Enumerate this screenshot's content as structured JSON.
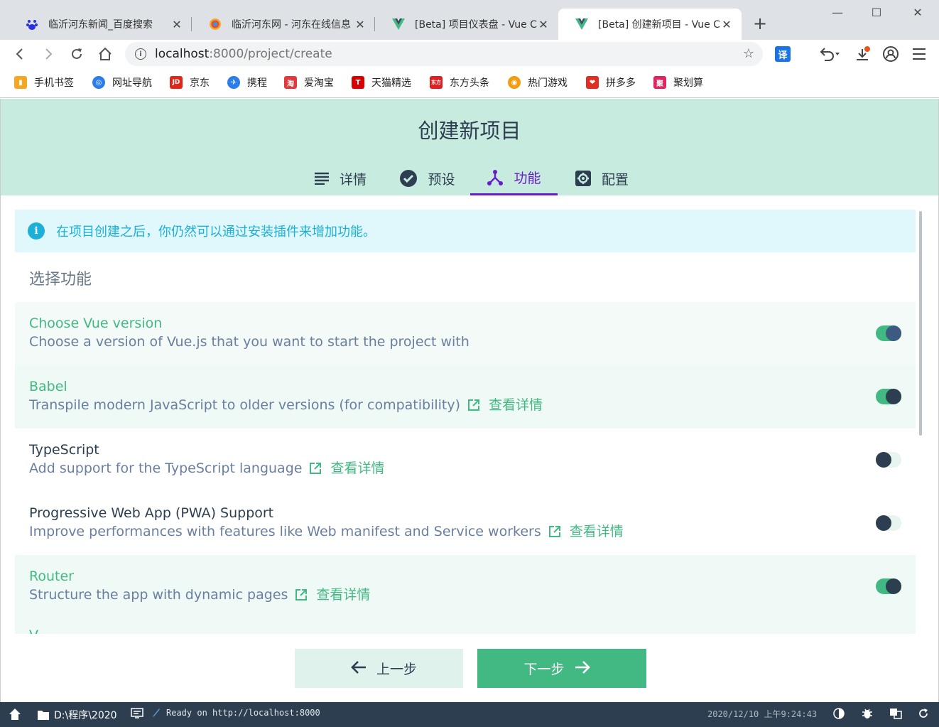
{
  "browser": {
    "tabs": [
      {
        "title": "临沂河东新闻_百度搜索",
        "icon": "baidu-icon",
        "active": false
      },
      {
        "title": "临沂河东网 - 河东在线信息",
        "icon": "rainbow-icon",
        "active": false
      },
      {
        "title": "[Beta] 项目仪表盘 - Vue CLI",
        "icon": "vue-icon",
        "active": false
      },
      {
        "title": "[Beta] 创建新项目 - Vue CLI",
        "icon": "vue-icon",
        "active": true
      }
    ],
    "close_glyph": "✕",
    "new_tab_glyph": "+",
    "url_host": "localhost",
    "url_path": ":8000/project/create",
    "translate_label": "译",
    "bookmarks": [
      {
        "label": "手机书签",
        "icon": "phone-bookmark-icon",
        "color": "#f5a623",
        "glyph": "▮"
      },
      {
        "label": "网址导航",
        "icon": "nav-icon",
        "color": "#2b7de9",
        "glyph": "◎"
      },
      {
        "label": "京东",
        "icon": "jd-icon",
        "color": "#e1251b",
        "glyph": "JD"
      },
      {
        "label": "携程",
        "icon": "ctrip-icon",
        "color": "#2b7de9",
        "glyph": "✈"
      },
      {
        "label": "爱淘宝",
        "icon": "taobao-icon",
        "color": "#e4393c",
        "glyph": "淘"
      },
      {
        "label": "天猫精选",
        "icon": "tmall-icon",
        "color": "#d80000",
        "glyph": "T"
      },
      {
        "label": "东方头条",
        "icon": "dftt-icon",
        "color": "#e02020",
        "glyph": "东方"
      },
      {
        "label": "热门游戏",
        "icon": "game-icon",
        "color": "#f39c12",
        "glyph": "◉"
      },
      {
        "label": "拼多多",
        "icon": "pdd-icon",
        "color": "#e02e24",
        "glyph": "❤"
      },
      {
        "label": "聚划算",
        "icon": "juhuasuan-icon",
        "color": "#e0245e",
        "glyph": "聚"
      }
    ]
  },
  "app": {
    "title": "创建新项目",
    "steps": [
      {
        "label": "详情",
        "icon": "list-icon",
        "active": false
      },
      {
        "label": "预设",
        "icon": "check-circle-icon",
        "active": false
      },
      {
        "label": "功能",
        "icon": "fork-icon",
        "active": true
      },
      {
        "label": "配置",
        "icon": "settings-icon",
        "active": false
      }
    ],
    "info_glyph": "i",
    "info_text": "在项目创建之后，你仍然可以通过安装插件来增加功能。",
    "section_title": "选择功能",
    "more_label": "查看详情",
    "features": [
      {
        "name": "Choose Vue version",
        "desc": "Choose a version of Vue.js that you want to start the project with",
        "enabled": true,
        "has_link": false
      },
      {
        "name": "Babel",
        "desc": "Transpile modern JavaScript to older versions (for compatibility)",
        "enabled": true,
        "has_link": true
      },
      {
        "name": "TypeScript",
        "desc": "Add support for the TypeScript language",
        "enabled": false,
        "has_link": true
      },
      {
        "name": "Progressive Web App (PWA) Support",
        "desc": "Improve performances with features like Web manifest and Service workers",
        "enabled": false,
        "has_link": true
      },
      {
        "name": "Router",
        "desc": "Structure the app with dynamic pages",
        "enabled": true,
        "has_link": true
      }
    ],
    "cut_off_text": "V",
    "prev_label": "上一步",
    "next_label": "下一步",
    "accent_color": "#42b983",
    "active_tab_color": "#6a1bc8"
  },
  "taskbar": {
    "folder": "D:\\程序\\2020",
    "status": "Ready on http://localhost:8000",
    "datetime": "2020/12/10 上午9:24:43"
  }
}
